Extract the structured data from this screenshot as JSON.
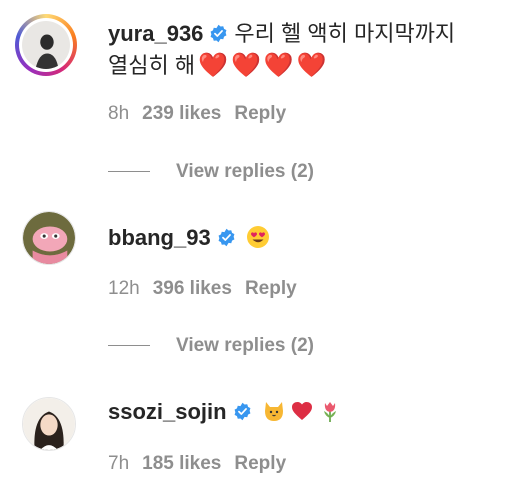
{
  "comments": [
    {
      "username": "yura_936",
      "text_line1": "우리 헬 액히 마지막까지",
      "text_line2": "열심히 해",
      "hearts": [
        "❤️",
        "❤️",
        "❤️",
        "❤️"
      ],
      "time": "8h",
      "likes": "239 likes",
      "reply": "Reply",
      "view_replies": "View replies (2)"
    },
    {
      "username": "bbang_93",
      "emoji": "heart-eyes-emoji",
      "time": "12h",
      "likes": "396 likes",
      "reply": "Reply",
      "view_replies": "View replies (2)"
    },
    {
      "username": "ssozi_sojin",
      "emojis": [
        "cat-emoji",
        "red-heart-emoji",
        "tulip-emoji"
      ],
      "time": "7h",
      "likes": "185 likes",
      "reply": "Reply"
    }
  ],
  "colors": {
    "verified": "#3897f0",
    "muted": "#8e8e8e",
    "heart": "#ed1c24"
  }
}
